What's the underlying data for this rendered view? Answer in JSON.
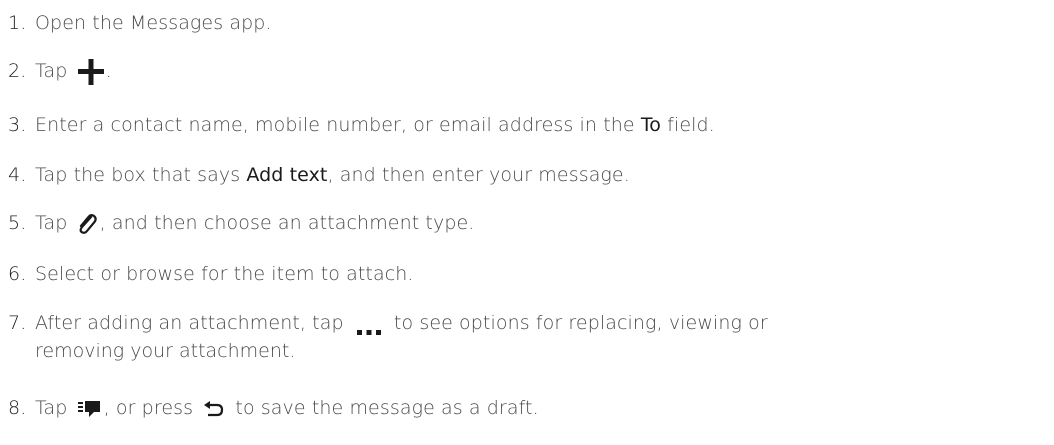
{
  "steps": [
    {
      "num": "1.",
      "text": "Open the Messages app."
    },
    {
      "num": "2.",
      "text_before": "Tap",
      "text_after": "."
    },
    {
      "num": "3.",
      "text_before": "Enter a contact name, mobile number, or email address in the",
      "ui": "To",
      "text_after": "field."
    },
    {
      "num": "4.",
      "text_before": "Tap the box that says",
      "ui": "Add text",
      "text_after": ", and then enter your message."
    },
    {
      "num": "5.",
      "text_before": "Tap",
      "text_after": ", and then choose an attachment type."
    },
    {
      "num": "6.",
      "text": "Select or browse for the item to attach."
    },
    {
      "num": "7.",
      "text_before": "After adding an attachment, tap",
      "text_after": "to see options for replacing, viewing or",
      "text_line2": "removing your attachment."
    },
    {
      "num": "8.",
      "text_before": "Tap",
      "text_middle": ", or press",
      "text_after": "to save the message as a draft."
    }
  ],
  "icons": {
    "plus": "plus-icon",
    "attach": "paperclip-icon",
    "more": "more-icon",
    "send": "send-icon",
    "back": "back-icon"
  }
}
